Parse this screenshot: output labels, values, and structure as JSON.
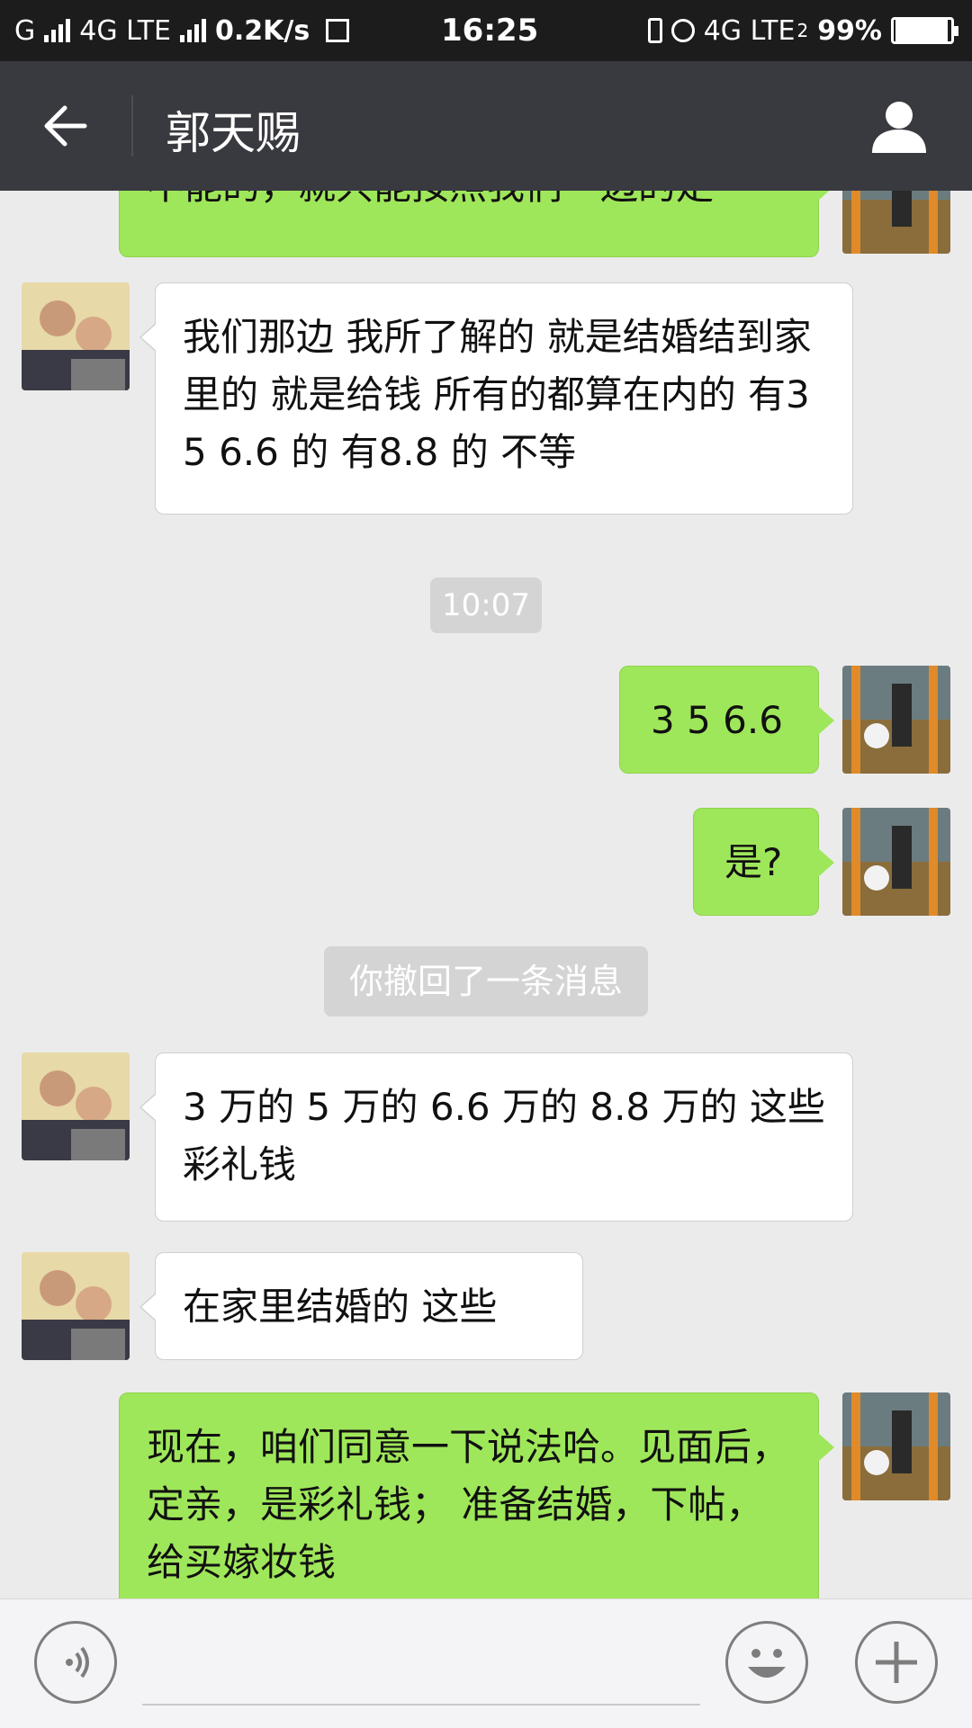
{
  "status_bar": {
    "net1": "G",
    "net2": "4G LTE",
    "speed": "0.2K/s",
    "time": "16:25",
    "net3": "4G LTE",
    "sim": "2",
    "battery": "99%",
    "battery_level": 0.99
  },
  "header": {
    "title": "郭天赐",
    "back_icon": "arrow-left-icon",
    "profile_icon": "person-icon"
  },
  "messages": [
    {
      "side": "out",
      "text": "不能的，就只能按照我们一边的走"
    },
    {
      "side": "in",
      "text": "我们那边 我所了解的 就是结婚结到家里的  就是给钱 所有的都算在内的 有3 5 6.6 的  有8.8 的   不等"
    },
    {
      "side": "time",
      "text": "10:07"
    },
    {
      "side": "out",
      "text": "3 5 6.6"
    },
    {
      "side": "out",
      "text": "是?"
    },
    {
      "side": "system",
      "text": "你撤回了一条消息"
    },
    {
      "side": "in",
      "text": "3 万的  5 万的 6.6 万的  8.8 万的 这些彩礼钱"
    },
    {
      "side": "in",
      "text": "在家里结婚的  这些"
    },
    {
      "side": "out",
      "text": "现在，咱们同意一下说法哈。见面后，定亲，是彩礼钱；  准备结婚，下帖，给买嫁妆钱"
    }
  ],
  "input_bar": {
    "voice_icon": "voice-icon",
    "emoji_icon": "emoji-icon",
    "plus_icon": "plus-icon"
  },
  "colors": {
    "status_bar": "#1c1c1c",
    "title_bar": "#393a3f",
    "background": "#ebebeb",
    "outgoing_bubble": "#9fe75a",
    "incoming_bubble": "#ffffff",
    "timestamp_pill": "#d4d4d4"
  }
}
